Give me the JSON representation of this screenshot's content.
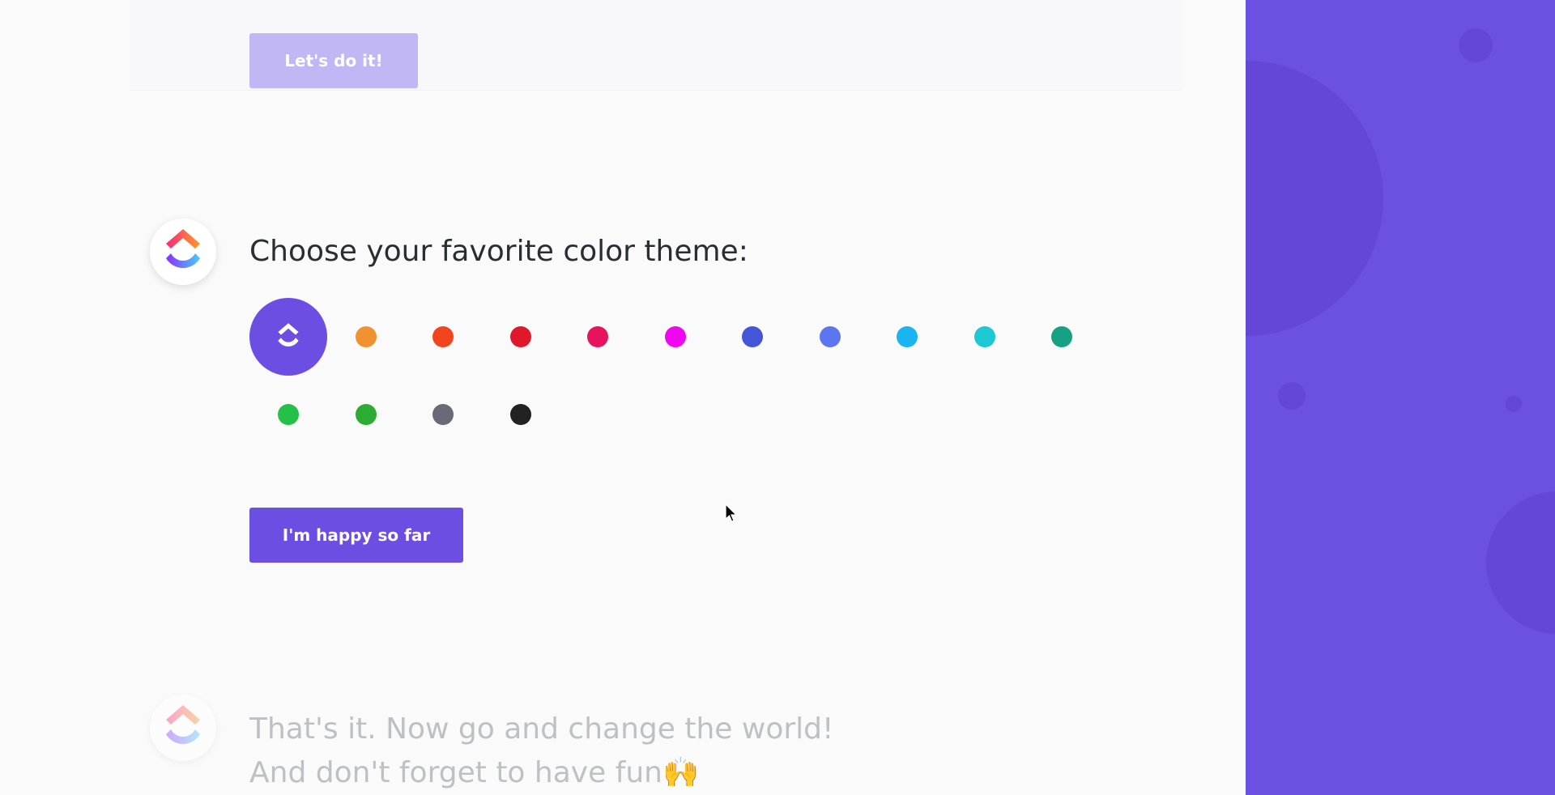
{
  "previous_step": {
    "button_label": "Let's do it!"
  },
  "theme_step": {
    "heading": "Choose your favorite color theme:",
    "selected_theme": "purple",
    "swatches": [
      {
        "name": "purple",
        "color": "#6c4ee3"
      },
      {
        "name": "orange",
        "color": "#f0922f"
      },
      {
        "name": "red-orange",
        "color": "#f1441f"
      },
      {
        "name": "red",
        "color": "#e0182b"
      },
      {
        "name": "crimson",
        "color": "#e8135f"
      },
      {
        "name": "magenta",
        "color": "#ef07ef"
      },
      {
        "name": "royal-blue",
        "color": "#4256d7"
      },
      {
        "name": "periwinkle",
        "color": "#5c75f0"
      },
      {
        "name": "sky-blue",
        "color": "#19b4f2"
      },
      {
        "name": "cyan",
        "color": "#1cc8d3"
      },
      {
        "name": "teal",
        "color": "#17a184"
      },
      {
        "name": "green",
        "color": "#25c048"
      },
      {
        "name": "dark-green",
        "color": "#2cac32"
      },
      {
        "name": "gray",
        "color": "#696a77"
      },
      {
        "name": "black",
        "color": "#222222"
      }
    ],
    "continue_label": "I'm happy so far"
  },
  "final_step": {
    "line1": "That's it. Now go and change the world!",
    "line2": "And don't forget to have fun",
    "emoji": "🙌"
  },
  "colors": {
    "accent": "#6c4ee3",
    "side_panel": "#6c50e1",
    "faded_button": "#c2b7f5"
  }
}
